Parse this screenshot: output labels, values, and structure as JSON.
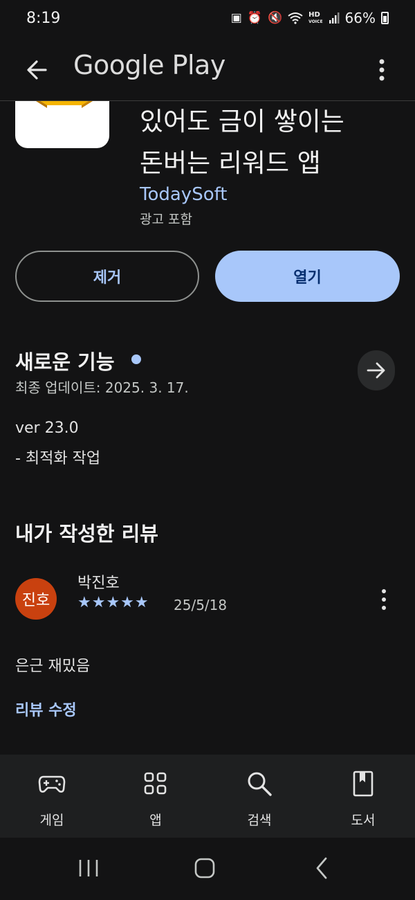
{
  "status_bar": {
    "time": "8:19",
    "battery": "66%"
  },
  "app_bar": {
    "title": "Google Play"
  },
  "app": {
    "name_line1": "있어도 금이 쌓이는",
    "name_line2": "돈버는 리워드 앱",
    "developer": "TodaySoft",
    "ads_note": "광고 포함"
  },
  "actions": {
    "remove_label": "제거",
    "open_label": "열기"
  },
  "whats_new": {
    "title": "새로운 기능",
    "updated": "최종 업데이트: 2025. 3. 17.",
    "version": "ver 23.0",
    "note": "- 최적화 작업"
  },
  "my_review": {
    "title": "내가 작성한 리뷰",
    "avatar_text": "진호",
    "reviewer": "박진호",
    "rating": 5,
    "stars": "★★★★★",
    "date": "25/5/18",
    "text": "은근 재밌음",
    "edit_label": "리뷰 수정"
  },
  "bottom_nav": {
    "items": [
      {
        "label": "게임",
        "icon": "gamepad-icon"
      },
      {
        "label": "앱",
        "icon": "apps-grid-icon"
      },
      {
        "label": "검색",
        "icon": "search-icon"
      },
      {
        "label": "도서",
        "icon": "book-icon"
      }
    ]
  },
  "colors": {
    "background": "#131314",
    "accent": "#a8c7fa",
    "open_button_text": "#062e6f",
    "avatar": "#c9410f",
    "nav_background": "#1e1f20"
  }
}
